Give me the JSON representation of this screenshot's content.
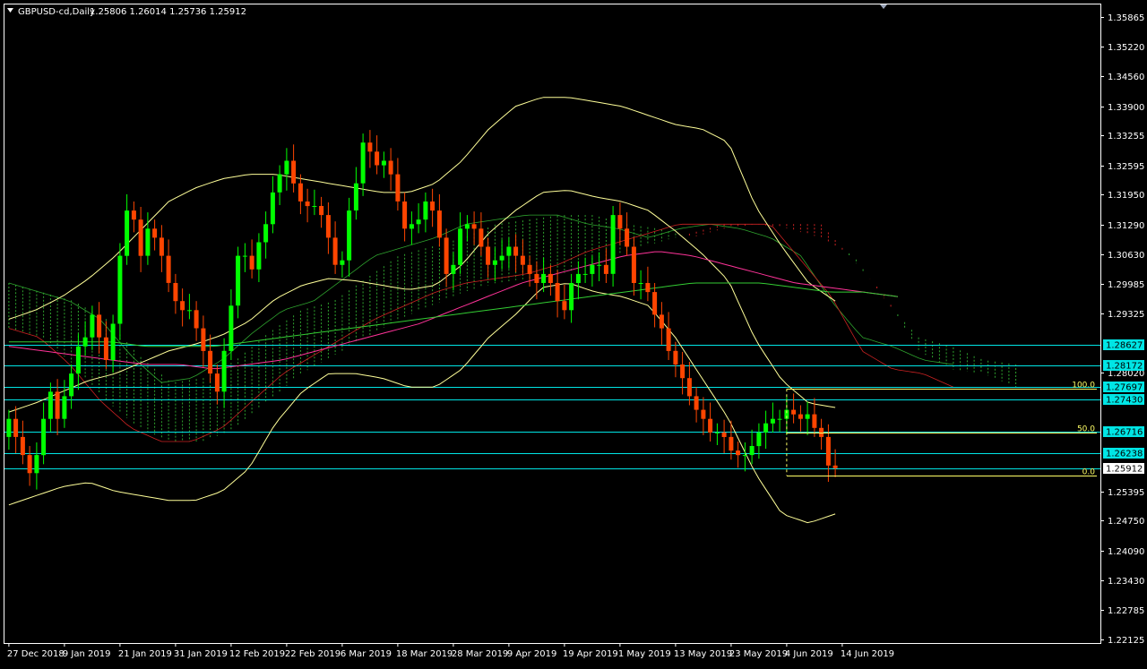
{
  "header": {
    "symbol_label": "GBPUSD-cd,Daily",
    "ohlc": "1.25806 1.26014 1.25736 1.25912"
  },
  "colors": {
    "background": "#000000",
    "foreground": "#ffffff",
    "bull_candle": "#00ff00",
    "bear_candle": "#ff4500",
    "bollinger": "#ffff99",
    "ma_fast": "#ff3399",
    "ma_slow": "#33cc33",
    "cloud_bull": "#2ea32e",
    "cloud_bear": "#cc2222",
    "horizontal_line": "#00e5e5",
    "fib_line": "#ffff66",
    "label_bg": "#00e5e5"
  },
  "chart_data": {
    "type": "candlestick",
    "price_axis": {
      "ticks": [
        "1.35865",
        "1.35220",
        "1.34560",
        "1.33900",
        "1.33255",
        "1.32595",
        "1.31950",
        "1.31290",
        "1.30630",
        "1.29985",
        "1.29325",
        "1.28020",
        "1.25395",
        "1.24750",
        "1.24090",
        "1.23430",
        "1.22785",
        "1.22125"
      ],
      "ylim": [
        1.2205,
        1.3615
      ]
    },
    "date_axis": {
      "labels": [
        "27 Dec 2018",
        "9 Jan 2019",
        "21 Jan 2019",
        "31 Jan 2019",
        "12 Feb 2019",
        "22 Feb 2019",
        "6 Mar 2019",
        "18 Mar 2019",
        "28 Mar 2019",
        "9 Apr 2019",
        "19 Apr 2019",
        "1 May 2019",
        "13 May 2019",
        "23 May 2019",
        "4 Jun 2019",
        "14 Jun 2019"
      ],
      "label_bars": [
        0,
        8,
        16,
        24,
        32,
        40,
        48,
        56,
        64,
        72,
        80,
        88,
        96,
        104,
        112,
        120
      ]
    },
    "closes": [
      1.27,
      1.266,
      1.262,
      1.258,
      1.262,
      1.27,
      1.276,
      1.27,
      1.275,
      1.28,
      1.286,
      1.288,
      1.293,
      1.288,
      1.283,
      1.291,
      1.306,
      1.316,
      1.314,
      1.306,
      1.312,
      1.31,
      1.306,
      1.3,
      1.296,
      1.294,
      1.294,
      1.29,
      1.285,
      1.28,
      1.276,
      1.285,
      1.295,
      1.306,
      1.306,
      1.303,
      1.309,
      1.313,
      1.32,
      1.324,
      1.327,
      1.322,
      1.318,
      1.317,
      1.317,
      1.315,
      1.31,
      1.304,
      1.305,
      1.316,
      1.322,
      1.331,
      1.329,
      1.326,
      1.327,
      1.324,
      1.318,
      1.312,
      1.313,
      1.314,
      1.318,
      1.316,
      1.31,
      1.302,
      1.304,
      1.312,
      1.313,
      1.312,
      1.308,
      1.304,
      1.305,
      1.306,
      1.308,
      1.306,
      1.304,
      1.302,
      1.3,
      1.302,
      1.3,
      1.296,
      1.294,
      1.3,
      1.302,
      1.302,
      1.304,
      1.304,
      1.302,
      1.315,
      1.312,
      1.308,
      1.3,
      1.3,
      1.298,
      1.293,
      1.29,
      1.285,
      1.282,
      1.279,
      1.275,
      1.272,
      1.27,
      1.267,
      1.267,
      1.266,
      1.263,
      1.262,
      1.262,
      1.264,
      1.267,
      1.269,
      1.27,
      1.27,
      1.272,
      1.271,
      1.27,
      1.271,
      1.268,
      1.266,
      1.2597,
      1.2591
    ],
    "bollinger": {
      "upper": [
        1.292,
        1.294,
        1.297,
        1.301,
        1.306,
        1.312,
        1.318,
        1.321,
        1.323,
        1.324,
        1.324,
        1.323,
        1.322,
        1.321,
        1.32,
        1.32,
        1.322,
        1.327,
        1.334,
        1.339,
        1.341,
        1.341,
        1.34,
        1.339,
        1.337,
        1.335,
        1.334,
        1.331,
        1.317,
        1.308,
        1.3,
        1.296
      ],
      "lower": [
        1.251,
        1.253,
        1.255,
        1.256,
        1.254,
        1.253,
        1.252,
        1.252,
        1.254,
        1.259,
        1.269,
        1.276,
        1.28,
        1.28,
        1.279,
        1.277,
        1.277,
        1.281,
        1.288,
        1.293,
        1.299,
        1.3,
        1.298,
        1.297,
        1.295,
        1.288,
        1.279,
        1.27,
        1.258,
        1.249,
        1.247,
        1.249
      ]
    },
    "ma_fast": [
      1.286,
      1.285,
      1.284,
      1.283,
      1.282,
      1.282,
      1.281,
      1.282,
      1.283,
      1.285,
      1.287,
      1.289,
      1.291,
      1.294,
      1.297,
      1.3,
      1.302,
      1.304,
      1.306,
      1.307,
      1.306,
      1.304,
      1.302,
      1.3,
      1.299,
      1.298,
      1.297
    ],
    "ma_slow": [
      1.287,
      1.287,
      1.287,
      1.287,
      1.286,
      1.286,
      1.286,
      1.287,
      1.288,
      1.289,
      1.29,
      1.291,
      1.292,
      1.293,
      1.294,
      1.295,
      1.296,
      1.297,
      1.298,
      1.299,
      1.3,
      1.3,
      1.3,
      1.299,
      1.298,
      1.298,
      1.297
    ],
    "ichimoku_cloud": {
      "span_a": [
        1.3,
        1.298,
        1.296,
        1.292,
        1.284,
        1.278,
        1.279,
        1.283,
        1.289,
        1.294,
        1.296,
        1.301,
        1.306,
        1.308,
        1.31,
        1.313,
        1.314,
        1.315,
        1.315,
        1.313,
        1.312,
        1.31,
        1.312,
        1.313,
        1.312,
        1.31,
        1.306,
        1.296,
        1.288,
        1.286,
        1.283,
        1.282
      ],
      "span_b": [
        1.29,
        1.288,
        1.282,
        1.274,
        1.268,
        1.265,
        1.265,
        1.268,
        1.274,
        1.28,
        1.284,
        1.288,
        1.292,
        1.295,
        1.298,
        1.3,
        1.301,
        1.302,
        1.304,
        1.307,
        1.309,
        1.311,
        1.313,
        1.313,
        1.313,
        1.313,
        1.305,
        1.297,
        1.285,
        1.281,
        1.28,
        1.277
      ]
    },
    "horizontal_lines": [
      {
        "price": 1.28627,
        "label": "1.28627"
      },
      {
        "price": 1.28172,
        "label": "1.28172"
      },
      {
        "price": 1.27697,
        "label": "1.27697"
      },
      {
        "price": 1.2743,
        "label": "1.27430"
      },
      {
        "price": 1.26716,
        "label": "1.26716"
      },
      {
        "price": 1.26238,
        "label": "1.26238"
      },
      {
        "price": 1.25912,
        "label": "1.25912"
      }
    ],
    "fibonacci": [
      {
        "level": "100.0",
        "price": 1.2766
      },
      {
        "level": "50.0",
        "price": 1.267
      },
      {
        "level": "0.0",
        "price": 1.2575
      }
    ]
  }
}
